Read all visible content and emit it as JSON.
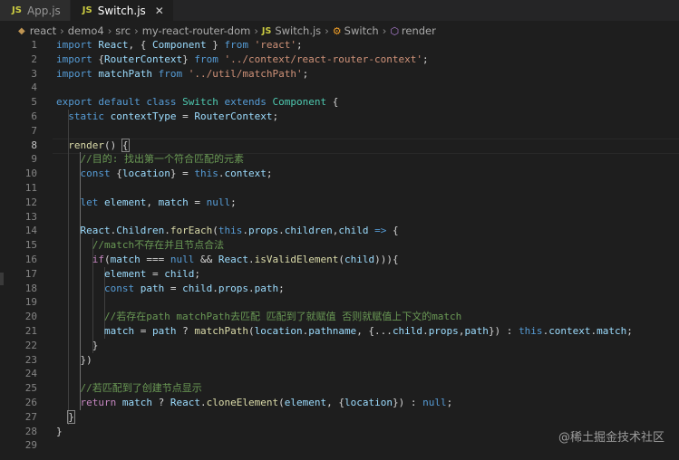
{
  "tabs": [
    {
      "label": "App.js",
      "icon": "js-icon",
      "badge": "JS",
      "active": false
    },
    {
      "label": "Switch.js",
      "icon": "js-icon",
      "badge": "JS",
      "active": true
    }
  ],
  "breadcrumb": [
    "react",
    "demo4",
    "src",
    "my-react-router-dom",
    "Switch.js",
    "Switch",
    "render"
  ],
  "breadcrumb_js_badge": "JS",
  "current_line": 8,
  "watermark": "@稀土掘金技术社区",
  "lines": [
    {
      "n": "1",
      "tokens": [
        [
          "kw",
          "import"
        ],
        [
          "pl",
          " "
        ],
        [
          "var",
          "React"
        ],
        [
          "pl",
          ", { "
        ],
        [
          "var",
          "Component"
        ],
        [
          "pl",
          " } "
        ],
        [
          "kw",
          "from"
        ],
        [
          "pl",
          " "
        ],
        [
          "str",
          "'react'"
        ],
        [
          "pl",
          ";"
        ]
      ]
    },
    {
      "n": "2",
      "tokens": [
        [
          "kw",
          "import"
        ],
        [
          "pl",
          " {"
        ],
        [
          "var",
          "RouterContext"
        ],
        [
          "pl",
          "} "
        ],
        [
          "kw",
          "from"
        ],
        [
          "pl",
          " "
        ],
        [
          "str",
          "'../context/react-router-context'"
        ],
        [
          "pl",
          ";"
        ]
      ]
    },
    {
      "n": "3",
      "tokens": [
        [
          "kw",
          "import"
        ],
        [
          "pl",
          " "
        ],
        [
          "var",
          "matchPath"
        ],
        [
          "pl",
          " "
        ],
        [
          "kw",
          "from"
        ],
        [
          "pl",
          " "
        ],
        [
          "str",
          "'../util/matchPath'"
        ],
        [
          "pl",
          ";"
        ]
      ]
    },
    {
      "n": "4",
      "tokens": []
    },
    {
      "n": "5",
      "tokens": [
        [
          "kw",
          "export"
        ],
        [
          "pl",
          " "
        ],
        [
          "kw",
          "default"
        ],
        [
          "pl",
          " "
        ],
        [
          "kw",
          "class"
        ],
        [
          "pl",
          " "
        ],
        [
          "cls",
          "Switch"
        ],
        [
          "pl",
          " "
        ],
        [
          "kw",
          "extends"
        ],
        [
          "pl",
          " "
        ],
        [
          "cls",
          "Component"
        ],
        [
          "pl",
          " {"
        ]
      ]
    },
    {
      "n": "6",
      "tokens": [
        [
          "pl",
          "  "
        ],
        [
          "kw",
          "static"
        ],
        [
          "pl",
          " "
        ],
        [
          "var",
          "contextType"
        ],
        [
          "pl",
          " = "
        ],
        [
          "var",
          "RouterContext"
        ],
        [
          "pl",
          ";"
        ]
      ]
    },
    {
      "n": "7",
      "tokens": []
    },
    {
      "n": "8",
      "tokens": [
        [
          "pl",
          "  "
        ],
        [
          "fn",
          "render"
        ],
        [
          "pl",
          "() "
        ],
        [
          "pl",
          "{"
        ]
      ]
    },
    {
      "n": "9",
      "tokens": [
        [
          "pl",
          "    "
        ],
        [
          "cmt",
          "//目的: 找出第一个符合匹配的元素"
        ]
      ]
    },
    {
      "n": "10",
      "tokens": [
        [
          "pl",
          "    "
        ],
        [
          "kw",
          "const"
        ],
        [
          "pl",
          " {"
        ],
        [
          "var",
          "location"
        ],
        [
          "pl",
          "} = "
        ],
        [
          "kw",
          "this"
        ],
        [
          "pl",
          "."
        ],
        [
          "var",
          "context"
        ],
        [
          "pl",
          ";"
        ]
      ]
    },
    {
      "n": "11",
      "tokens": []
    },
    {
      "n": "12",
      "tokens": [
        [
          "pl",
          "    "
        ],
        [
          "kw",
          "let"
        ],
        [
          "pl",
          " "
        ],
        [
          "var",
          "element"
        ],
        [
          "pl",
          ", "
        ],
        [
          "var",
          "match"
        ],
        [
          "pl",
          " = "
        ],
        [
          "kw",
          "null"
        ],
        [
          "pl",
          ";"
        ]
      ]
    },
    {
      "n": "13",
      "tokens": []
    },
    {
      "n": "14",
      "tokens": [
        [
          "pl",
          "    "
        ],
        [
          "var",
          "React"
        ],
        [
          "pl",
          "."
        ],
        [
          "var",
          "Children"
        ],
        [
          "pl",
          "."
        ],
        [
          "fn",
          "forEach"
        ],
        [
          "pl",
          "("
        ],
        [
          "kw",
          "this"
        ],
        [
          "pl",
          "."
        ],
        [
          "var",
          "props"
        ],
        [
          "pl",
          "."
        ],
        [
          "var",
          "children"
        ],
        [
          "pl",
          ","
        ],
        [
          "var",
          "child"
        ],
        [
          "pl",
          " "
        ],
        [
          "kw",
          "=>"
        ],
        [
          "pl",
          " {"
        ]
      ]
    },
    {
      "n": "15",
      "tokens": [
        [
          "pl",
          "      "
        ],
        [
          "cmt",
          "//match不存在并且节点合法"
        ]
      ]
    },
    {
      "n": "16",
      "tokens": [
        [
          "pl",
          "      "
        ],
        [
          "ctl",
          "if"
        ],
        [
          "pl",
          "("
        ],
        [
          "var",
          "match"
        ],
        [
          "pl",
          " === "
        ],
        [
          "kw",
          "null"
        ],
        [
          "pl",
          " && "
        ],
        [
          "var",
          "React"
        ],
        [
          "pl",
          "."
        ],
        [
          "fn",
          "isValidElement"
        ],
        [
          "pl",
          "("
        ],
        [
          "var",
          "child"
        ],
        [
          "pl",
          "))){"
        ]
      ]
    },
    {
      "n": "17",
      "tokens": [
        [
          "pl",
          "        "
        ],
        [
          "var",
          "element"
        ],
        [
          "pl",
          " = "
        ],
        [
          "var",
          "child"
        ],
        [
          "pl",
          ";"
        ]
      ]
    },
    {
      "n": "18",
      "tokens": [
        [
          "pl",
          "        "
        ],
        [
          "kw",
          "const"
        ],
        [
          "pl",
          " "
        ],
        [
          "var",
          "path"
        ],
        [
          "pl",
          " = "
        ],
        [
          "var",
          "child"
        ],
        [
          "pl",
          "."
        ],
        [
          "var",
          "props"
        ],
        [
          "pl",
          "."
        ],
        [
          "var",
          "path"
        ],
        [
          "pl",
          ";"
        ]
      ]
    },
    {
      "n": "19",
      "tokens": []
    },
    {
      "n": "20",
      "tokens": [
        [
          "pl",
          "        "
        ],
        [
          "cmt",
          "//若存在path matchPath去匹配 匹配到了就赋值 否则就赋值上下文的match"
        ]
      ]
    },
    {
      "n": "21",
      "tokens": [
        [
          "pl",
          "        "
        ],
        [
          "var",
          "match"
        ],
        [
          "pl",
          " = "
        ],
        [
          "var",
          "path"
        ],
        [
          "pl",
          " ? "
        ],
        [
          "fn",
          "matchPath"
        ],
        [
          "pl",
          "("
        ],
        [
          "var",
          "location"
        ],
        [
          "pl",
          "."
        ],
        [
          "var",
          "pathname"
        ],
        [
          "pl",
          ", {..."
        ],
        [
          "var",
          "child"
        ],
        [
          "pl",
          "."
        ],
        [
          "var",
          "props"
        ],
        [
          "pl",
          ","
        ],
        [
          "var",
          "path"
        ],
        [
          "pl",
          "}) : "
        ],
        [
          "kw",
          "this"
        ],
        [
          "pl",
          "."
        ],
        [
          "var",
          "context"
        ],
        [
          "pl",
          "."
        ],
        [
          "var",
          "match"
        ],
        [
          "pl",
          ";"
        ]
      ]
    },
    {
      "n": "22",
      "tokens": [
        [
          "pl",
          "      }"
        ]
      ]
    },
    {
      "n": "23",
      "tokens": [
        [
          "pl",
          "    })"
        ]
      ]
    },
    {
      "n": "24",
      "tokens": []
    },
    {
      "n": "25",
      "tokens": [
        [
          "pl",
          "    "
        ],
        [
          "cmt",
          "//若匹配到了创建节点显示"
        ]
      ]
    },
    {
      "n": "26",
      "tokens": [
        [
          "pl",
          "    "
        ],
        [
          "ctl",
          "return"
        ],
        [
          "pl",
          " "
        ],
        [
          "var",
          "match"
        ],
        [
          "pl",
          " ? "
        ],
        [
          "var",
          "React"
        ],
        [
          "pl",
          "."
        ],
        [
          "fn",
          "cloneElement"
        ],
        [
          "pl",
          "("
        ],
        [
          "var",
          "element"
        ],
        [
          "pl",
          ", {"
        ],
        [
          "var",
          "location"
        ],
        [
          "pl",
          "}) : "
        ],
        [
          "kw",
          "null"
        ],
        [
          "pl",
          ";"
        ]
      ]
    },
    {
      "n": "27",
      "tokens": [
        [
          "pl",
          "  "
        ],
        [
          "pl",
          "}"
        ]
      ]
    },
    {
      "n": "28",
      "tokens": [
        [
          "pl",
          "}"
        ]
      ]
    },
    {
      "n": "29",
      "tokens": []
    }
  ]
}
